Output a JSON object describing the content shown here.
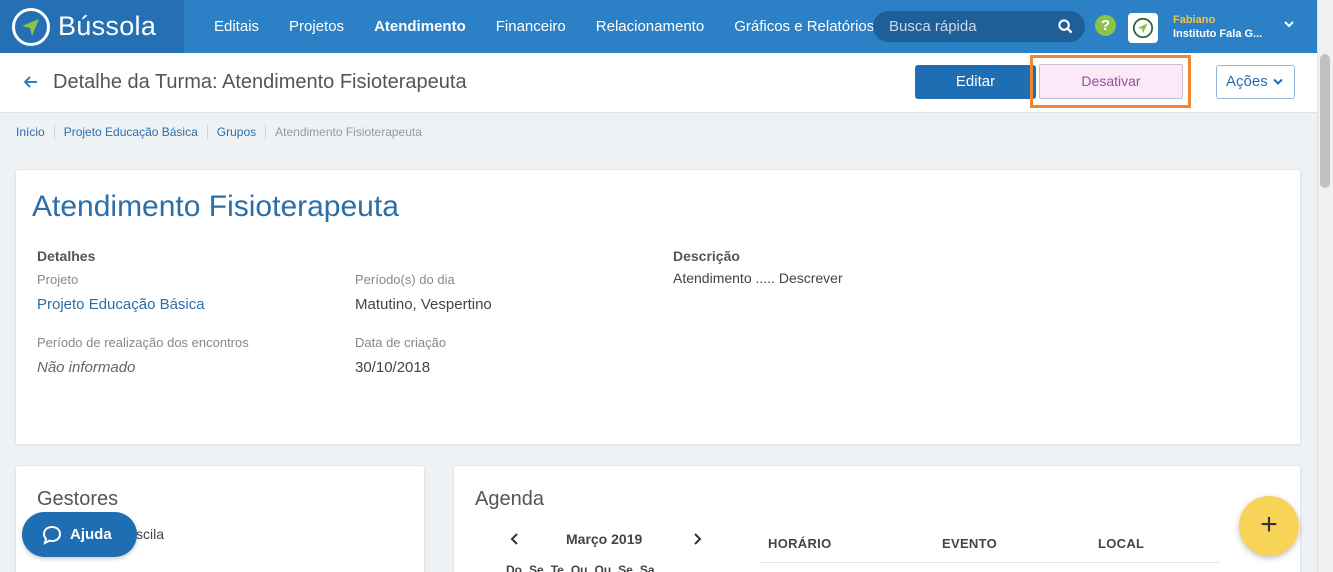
{
  "app": {
    "name": "Bússola"
  },
  "nav": {
    "items": [
      {
        "label": "Editais"
      },
      {
        "label": "Projetos"
      },
      {
        "label": "Atendimento",
        "active": true
      },
      {
        "label": "Financeiro"
      },
      {
        "label": "Relacionamento"
      },
      {
        "label": "Gráficos e Relatórios"
      }
    ],
    "search_placeholder": "Busca rápida",
    "help_glyph": "?"
  },
  "user": {
    "name": "Fabiano",
    "org": "Instituto Fala G..."
  },
  "header": {
    "title": "Detalhe da Turma: Atendimento Fisioterapeuta",
    "edit_label": "Editar",
    "deactivate_label": "Desativar",
    "actions_label": "Ações"
  },
  "breadcrumb": [
    "Início",
    "Projeto Educação Básica",
    "Grupos",
    "Atendimento Fisioterapeuta"
  ],
  "details": {
    "heading": "Atendimento Fisioterapeuta",
    "section_title": "Detalhes",
    "projeto_label": "Projeto",
    "projeto_value": "Projeto Educação Básica",
    "periodos_label": "Período(s) do dia",
    "periodos_value": "Matutino, Vespertino",
    "realizacao_label": "Período de realização dos encontros",
    "realizacao_value": "Não informado",
    "criacao_label": "Data de criação",
    "criacao_value": "30/10/2018",
    "descricao_title": "Descrição",
    "descricao_value": "Atendimento ..... Descrever"
  },
  "gestores": {
    "title": "Gestores",
    "name_partial": "scila"
  },
  "agenda": {
    "title": "Agenda",
    "month": "Março 2019",
    "weekdays": [
      "Do",
      "Se",
      "Te",
      "Qu",
      "Qu",
      "Se",
      "Sa"
    ],
    "columns": [
      "HORÁRIO",
      "EVENTO",
      "LOCAL"
    ]
  },
  "help_button": {
    "label": "Ajuda"
  },
  "fab": {
    "label": "+"
  },
  "colors": {
    "nav_bg": "#2c80c6",
    "brand_bg": "#2570b3",
    "primary": "#1f6db3",
    "highlight": "#f08632",
    "fab": "#f7d358"
  }
}
